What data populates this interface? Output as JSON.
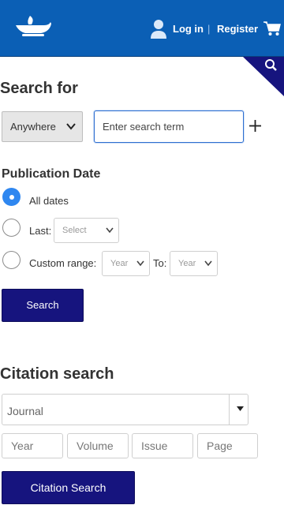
{
  "header": {
    "login_label": "Log in",
    "separator": "|",
    "register_label": "Register",
    "brand_color": "#0b5fb5"
  },
  "search": {
    "heading": "Search for",
    "scope_value": "Anywhere",
    "term_placeholder": "Enter search term"
  },
  "publication": {
    "heading": "Publication Date",
    "all_dates_label": "All dates",
    "last_label": "Last:",
    "last_select_value": "Select",
    "custom_label": "Custom range:",
    "from_year_value": "Year",
    "to_label": "To:",
    "to_year_value": "Year",
    "selected": "All dates",
    "search_button": "Search"
  },
  "citation": {
    "heading": "Citation search",
    "journal_placeholder": "Journal",
    "year_placeholder": "Year",
    "volume_placeholder": "Volume",
    "issue_placeholder": "Issue",
    "page_placeholder": "Page",
    "button_label": "Citation Search",
    "button_color": "#16147e"
  },
  "icons": [
    "lamp-logo-icon",
    "user-icon",
    "cart-icon",
    "search-icon",
    "plus-icon",
    "chevron-down-icon",
    "caret-down-icon"
  ]
}
